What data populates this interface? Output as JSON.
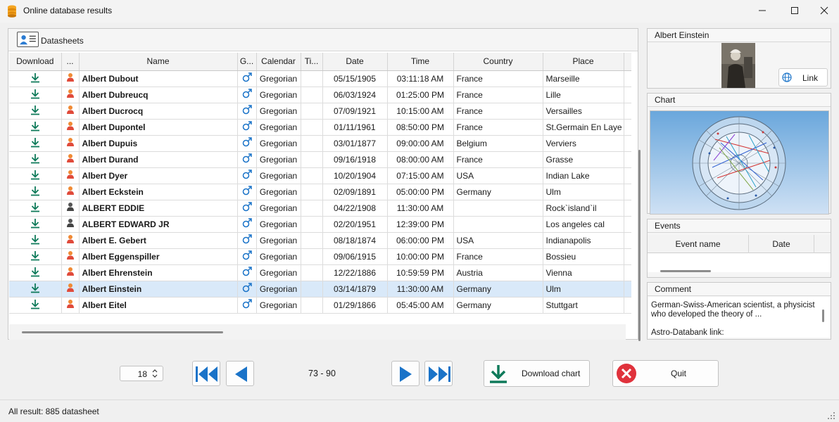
{
  "window": {
    "title": "Online database results"
  },
  "datasheets": {
    "label": "Datasheets",
    "columns": [
      "Download",
      "...",
      "Name",
      "G...",
      "Calendar",
      "Ti...",
      "Date",
      "Time",
      "Country",
      "Place"
    ],
    "rows": [
      {
        "name": "Albert Dubout",
        "calendar": "Gregorian",
        "date": "05/15/1905",
        "time": "03:11:18 AM",
        "country": "France",
        "place": "Marseille",
        "person_icon": "person-orange-icon",
        "selected": false
      },
      {
        "name": "Albert Dubreucq",
        "calendar": "Gregorian",
        "date": "06/03/1924",
        "time": "01:25:00 PM",
        "country": "France",
        "place": "Lille",
        "person_icon": "person-orange-icon",
        "selected": false
      },
      {
        "name": "Albert Ducrocq",
        "calendar": "Gregorian",
        "date": "07/09/1921",
        "time": "10:15:00 AM",
        "country": "France",
        "place": "Versailles",
        "person_icon": "person-orange-icon",
        "selected": false
      },
      {
        "name": "Albert Dupontel",
        "calendar": "Gregorian",
        "date": "01/11/1961",
        "time": "08:50:00 PM",
        "country": "France",
        "place": "St.Germain En Laye",
        "person_icon": "person-orange-icon",
        "selected": false
      },
      {
        "name": "Albert Dupuis",
        "calendar": "Gregorian",
        "date": "03/01/1877",
        "time": "09:00:00 AM",
        "country": "Belgium",
        "place": "Verviers",
        "person_icon": "person-orange-icon",
        "selected": false
      },
      {
        "name": "Albert Durand",
        "calendar": "Gregorian",
        "date": "09/16/1918",
        "time": "08:00:00 AM",
        "country": "France",
        "place": "Grasse",
        "person_icon": "person-orange-icon",
        "selected": false
      },
      {
        "name": "Albert Dyer",
        "calendar": "Gregorian",
        "date": "10/20/1904",
        "time": "07:15:00 AM",
        "country": "USA",
        "place": "Indian Lake",
        "person_icon": "person-orange-icon",
        "selected": false
      },
      {
        "name": "Albert Eckstein",
        "calendar": "Gregorian",
        "date": "02/09/1891",
        "time": "05:00:00 PM",
        "country": "Germany",
        "place": "Ulm",
        "person_icon": "person-orange-icon",
        "selected": false
      },
      {
        "name": "ALBERT EDDIE",
        "calendar": "Gregorian",
        "date": "04/22/1908",
        "time": "11:30:00 AM",
        "country": "",
        "place": "Rock`island`il",
        "person_icon": "person-gray-icon",
        "selected": false
      },
      {
        "name": "ALBERT EDWARD JR",
        "calendar": "Gregorian",
        "date": "02/20/1951",
        "time": "12:39:00 PM",
        "country": "",
        "place": "Los angeles cal",
        "person_icon": "person-gray-icon",
        "selected": false
      },
      {
        "name": "Albert E. Gebert",
        "calendar": "Gregorian",
        "date": "08/18/1874",
        "time": "06:00:00 PM",
        "country": "USA",
        "place": "Indianapolis",
        "person_icon": "person-orange-icon",
        "selected": false
      },
      {
        "name": "Albert Eggenspiller",
        "calendar": "Gregorian",
        "date": "09/06/1915",
        "time": "10:00:00 PM",
        "country": "France",
        "place": "Bossieu",
        "person_icon": "person-orange-icon",
        "selected": false
      },
      {
        "name": "Albert Ehrenstein",
        "calendar": "Gregorian",
        "date": "12/22/1886",
        "time": "10:59:59 PM",
        "country": "Austria",
        "place": "Vienna",
        "person_icon": "person-orange-icon",
        "selected": false
      },
      {
        "name": "Albert Einstein",
        "calendar": "Gregorian",
        "date": "03/14/1879",
        "time": "11:30:00 AM",
        "country": "Germany",
        "place": "Ulm",
        "person_icon": "person-orange-icon",
        "selected": true
      },
      {
        "name": "Albert Eitel",
        "calendar": "Gregorian",
        "date": "01/29/1866",
        "time": "05:45:00 AM",
        "country": "Germany",
        "place": "Stuttgart",
        "person_icon": "person-orange-icon",
        "selected": false
      }
    ]
  },
  "person_panel": {
    "title": "Albert Einstein",
    "link_label": "Link"
  },
  "chart_panel": {
    "title": "Chart"
  },
  "events_panel": {
    "title": "Events",
    "columns": [
      "Event name",
      "Date"
    ]
  },
  "comment_panel": {
    "title": "Comment",
    "line1": "German-Swiss-American scientist, a physicist",
    "line2": "who developed the theory of ...",
    "line3": "Astro-Databank link:"
  },
  "navigation": {
    "page_size": "18",
    "range": "73 - 90",
    "download_chart_label": "Download chart",
    "quit_label": "Quit"
  },
  "status": {
    "text": "All result: 885 datasheet"
  },
  "colors": {
    "accent_blue": "#1a73c8",
    "download_green": "#0f7a5a",
    "quit_red": "#e0323c",
    "selected_row": "#d9e9f9"
  }
}
